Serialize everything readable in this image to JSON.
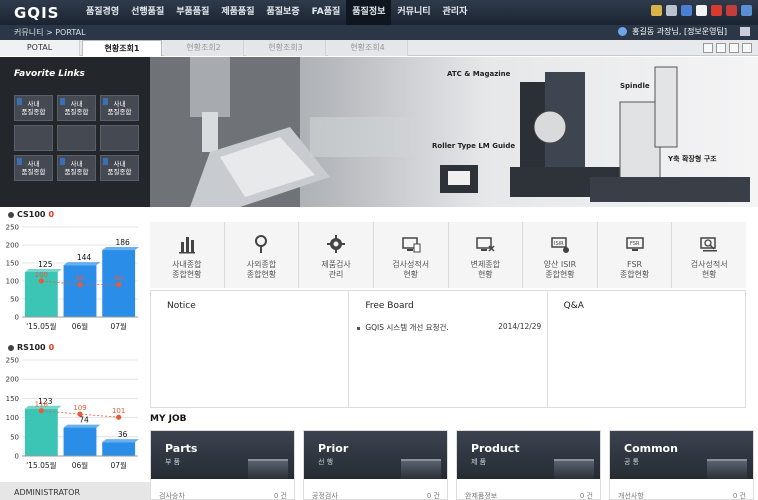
{
  "app": {
    "logo": "GQIS"
  },
  "nav": {
    "items": [
      "품질경영",
      "선행품질",
      "부품품질",
      "제품품질",
      "품질보증",
      "FA품질",
      "품질정보",
      "커뮤니티",
      "관리자"
    ],
    "active_index": 6
  },
  "breadcrumb": {
    "path": "커뮤니티  >  PORTAL"
  },
  "user": {
    "label": "홍길동 과장님, [정보운영팀]"
  },
  "tabs": [
    "POTAL",
    "현황조회1",
    "현황조회2",
    "현황조회3",
    "현황조회4"
  ],
  "active_tab_index": 1,
  "favorites": {
    "title": "Favorite Links",
    "items": [
      "사내\n품질종합",
      "사내\n품질종합",
      "사내\n품질종합",
      "",
      "",
      "",
      "사내\n품질종합",
      "사내\n품질종합",
      "사내\n품질종합"
    ]
  },
  "banner": {
    "labels": [
      "ATC & Magazine",
      "Spindle",
      "Roller Type LM Guide",
      "Y축 확장형 구조"
    ]
  },
  "quick_links": [
    {
      "label": "사내종합\n종합현황",
      "icon": "bar-chart-icon"
    },
    {
      "label": "사외종합\n종합현황",
      "icon": "location-pin-icon"
    },
    {
      "label": "제품검사\n관리",
      "icon": "gear-icon"
    },
    {
      "label": "검사성적서\n현황",
      "icon": "monitor-doc-icon"
    },
    {
      "label": "변제종합\n현황",
      "icon": "monitor-x-icon"
    },
    {
      "label": "양산 ISIR\n종합현황",
      "icon": "isir-icon"
    },
    {
      "label": "FSR\n종합현황",
      "icon": "fsr-icon"
    },
    {
      "label": "검사성적서\n현황",
      "icon": "monitor-search-icon"
    }
  ],
  "boards": [
    {
      "title": "Notice",
      "rows": []
    },
    {
      "title": "Free Board",
      "rows": [
        {
          "text": "GQIS 시스템 개선 요청건.",
          "date": "2014/12/29"
        }
      ]
    },
    {
      "title": "Q&A",
      "rows": []
    }
  ],
  "myjob": {
    "title": "MY JOB",
    "cards": [
      {
        "name": "Parts",
        "sub": "부 품",
        "row_label": "검사승차",
        "row_count": "0 건"
      },
      {
        "name": "Prior",
        "sub": "선 행",
        "row_label": "공정검사",
        "row_count": "0 건"
      },
      {
        "name": "Product",
        "sub": "제 품",
        "row_label": "완제품정보",
        "row_count": "0 건"
      },
      {
        "name": "Common",
        "sub": "공 통",
        "row_label": "개선사항",
        "row_count": "0 건"
      }
    ]
  },
  "admin_label": "ADMINISTRATOR",
  "chart_data": [
    {
      "type": "bar",
      "title_prefix": "CS100",
      "title_suffix": "0",
      "categories": [
        "'15.05월",
        "06월",
        "07월"
      ],
      "series": [
        {
          "values": [
            125,
            144,
            186
          ],
          "color": "#2a8ee8"
        },
        {
          "values": [
            100,
            90,
            90
          ],
          "color": "#e85a3a",
          "kind": "line"
        }
      ],
      "first_bar_color": "#3cc4b4",
      "ylim": [
        0,
        250
      ],
      "yticks": [
        0,
        50,
        100,
        150,
        200,
        250
      ]
    },
    {
      "type": "bar",
      "title_prefix": "RS100",
      "title_suffix": "0",
      "categories": [
        "'15.05월",
        "06월",
        "07월"
      ],
      "series": [
        {
          "values": [
            123,
            74,
            36
          ],
          "color": "#2a8ee8"
        },
        {
          "values": [
            118,
            109,
            101
          ],
          "color": "#e85a3a",
          "kind": "line"
        }
      ],
      "first_bar_color": "#3cc4b4",
      "ylim": [
        0,
        250
      ],
      "yticks": [
        0,
        50,
        100,
        150,
        200,
        250
      ]
    }
  ]
}
